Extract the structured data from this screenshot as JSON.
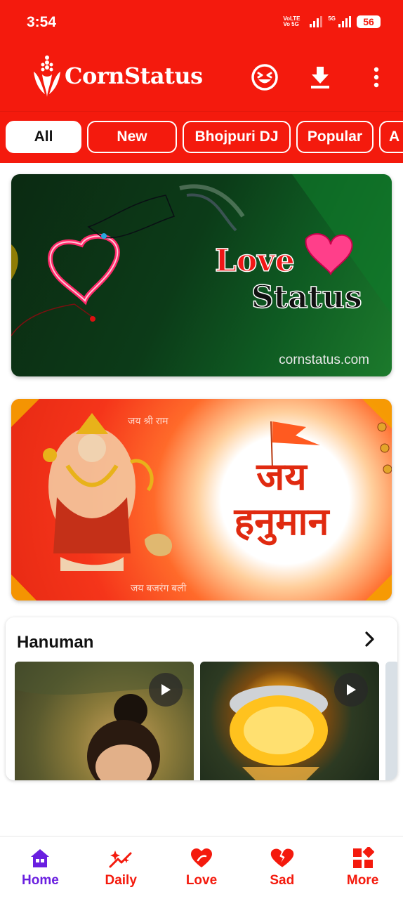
{
  "status_bar": {
    "time": "3:54",
    "network_label": "VoLTE Vo 5G",
    "fiveg_label": "5G",
    "battery": "56"
  },
  "header": {
    "app_name": "CornStatus",
    "icons": [
      "laughing-emoji-icon",
      "download-icon",
      "more-vertical-icon"
    ]
  },
  "categories": {
    "items": [
      {
        "label": "All",
        "active": true
      },
      {
        "label": "New",
        "active": false
      },
      {
        "label": "Bhojpuri DJ",
        "active": false
      },
      {
        "label": "Popular",
        "active": false
      },
      {
        "label": "A",
        "active": false
      }
    ]
  },
  "banners": {
    "love": {
      "title_1": "Love",
      "title_2": "Status",
      "site": "cornstatus.com"
    },
    "hanuman": {
      "top_text": "जय श्री राम",
      "main_text": "जय हनुमान",
      "bottom_text": "जय बजरंग बली"
    }
  },
  "section": {
    "title": "Hanuman",
    "arrow_icon": "chevron-right-icon",
    "play_icon": "play-icon"
  },
  "bottom_nav": {
    "items": [
      {
        "label": "Home",
        "icon": "home-icon",
        "active": true
      },
      {
        "label": "Daily",
        "icon": "sparkle-icon",
        "active": false
      },
      {
        "label": "Love",
        "icon": "heart-icon",
        "active": false
      },
      {
        "label": "Sad",
        "icon": "broken-heart-icon",
        "active": false
      },
      {
        "label": "More",
        "icon": "grid-icon",
        "active": false
      }
    ]
  },
  "colors": {
    "brand": "#f41a0d",
    "active_nav": "#6a1fe0"
  }
}
